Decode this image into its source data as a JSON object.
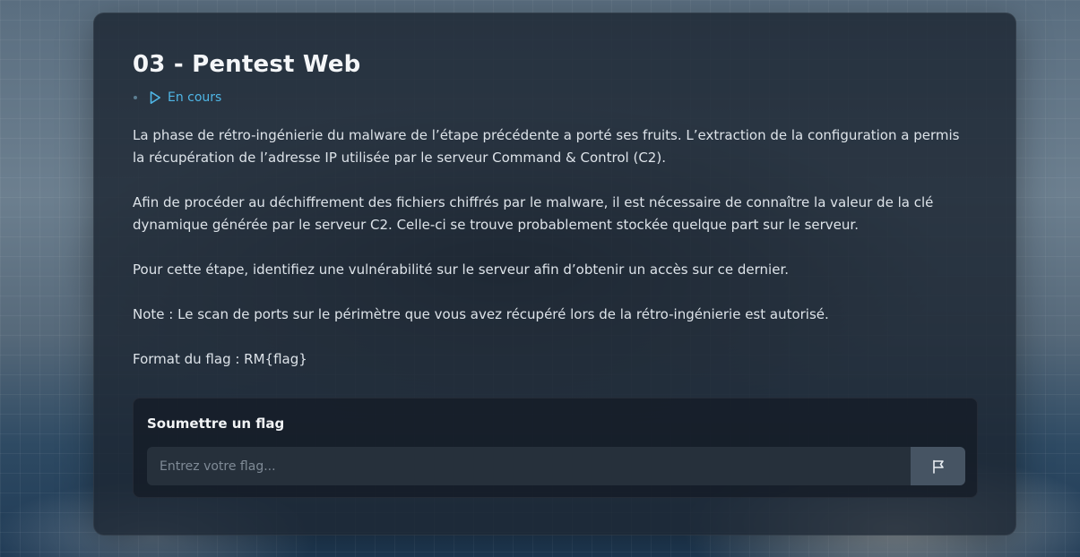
{
  "challenge": {
    "title": "03 - Pentest Web",
    "status": "En cours",
    "status_icon": "play-icon",
    "accent_color": "#4fb6e6",
    "paragraphs": [
      "La phase de rétro-ingénierie du malware de l’étape précédente a porté ses fruits. L’extraction de la configuration a permis la récupération de l’adresse IP utilisée par le serveur Command & Control (C2).",
      "Afin de procéder au déchiffrement des fichiers chiffrés par le malware, il est nécessaire de connaître la valeur de la clé dynamique générée par le serveur C2. Celle-ci se trouve probablement stockée quelque part sur le serveur.",
      "Pour cette étape, identifiez une vulnérabilité sur le serveur afin d’obtenir un accès sur ce dernier.",
      "Note : Le scan de ports sur le périmètre que vous avez récupéré lors de la rétro-ingénierie est autorisé.",
      "Format du flag : RM{flag}"
    ]
  },
  "submission": {
    "heading": "Soumettre un flag",
    "input_value": "",
    "placeholder": "Entrez votre flag...",
    "submit_icon": "flag-icon"
  }
}
